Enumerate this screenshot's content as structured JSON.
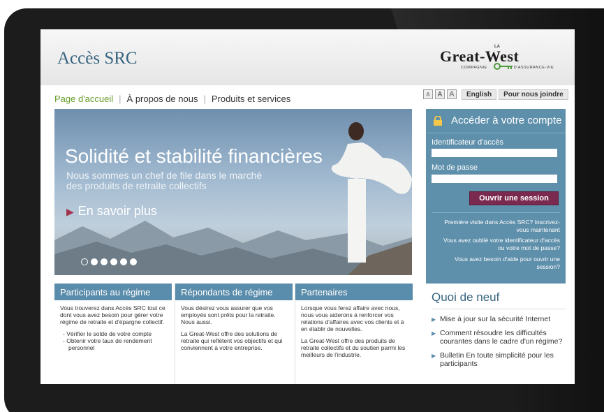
{
  "header": {
    "site_title": "Accès SRC",
    "brand": {
      "small": "LA",
      "name": "Great-West",
      "tagline_left": "COMPAGNIE",
      "tagline_right": "D'ASSURANCE-VIE"
    }
  },
  "nav": {
    "items": [
      "Page d'accueil",
      "À propos de nous",
      "Produits et services"
    ],
    "active_color": "#6a9e2c"
  },
  "utility": {
    "font_sizes": [
      "A",
      "A",
      "A"
    ],
    "english": "English",
    "contact": "Pour nous joindre"
  },
  "hero": {
    "title": "Solidité et stabilité financières",
    "subtitle": "Nous sommes un chef de file dans le marché des produits de retraite collectifs",
    "more": "En savoir plus",
    "slides_total": 6,
    "current_slide": 1
  },
  "login": {
    "title": "Accéder à votre compte",
    "id_label": "Identificateur d'accès",
    "password_label": "Mot de passe",
    "id_value": "",
    "password_value": "",
    "submit": "Ouvrir une session",
    "links": [
      "Première visite dans Accès SRC? Inscrivez-vous maintenant",
      "Vous avez oublié votre identificateur d'accès ou votre mot de passe?",
      "Vous avez besoin d'aide pour ouvrir une session?"
    ],
    "button_color": "#7b2a4f",
    "panel_color": "#5e8fab"
  },
  "columns": [
    {
      "title": "Participants au régime",
      "intro": "Vous trouverez dans Accès SRC tout ce dont vous avez besoin pour gérer votre régime de retraite et d'épargne collectif.",
      "bullets": [
        "Vérifier le solde de votre compte",
        "Obtenir votre taux de rendement personnel"
      ]
    },
    {
      "title": "Répondants de régime",
      "p1": "Vous désirez vous assurer que vos employés sont prêts pour la retraite. Nous aussi.",
      "p2": "La Great-West offre des solutions de retraite qui reflètent vos objectifs et qui conviennent à votre entreprise."
    },
    {
      "title": "Partenaires",
      "p1": "Lorsque vous ferez affaire avec nous, nous vous aiderons à renforcer vos relations d'affaires avec vos clients et à en établir de nouvelles.",
      "p2": "La Great-West offre des produits de retraite collectifs et du soutien parmi les meilleurs de l'industrie."
    }
  ],
  "news": {
    "title": "Quoi de neuf",
    "items": [
      "Mise à jour sur la sécurité Internet",
      "Comment résoudre les difficultés courantes dans le cadre d'un régime?",
      "Bulletin En toute simplicité pour les participants"
    ]
  },
  "colors": {
    "accent": "#35637e",
    "column_header": "#5a8cab"
  }
}
